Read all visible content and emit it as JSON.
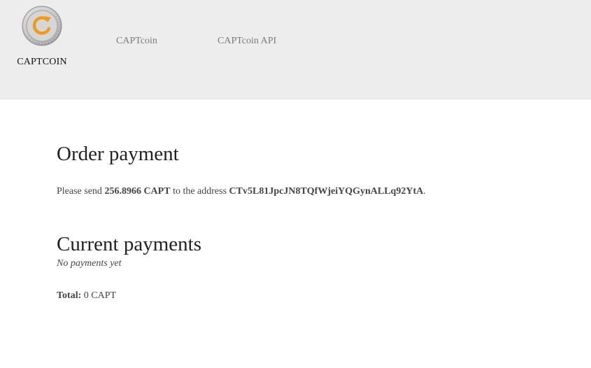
{
  "brand": {
    "name": "CAPTCOIN",
    "logo_icon": "captcoin-coin-icon",
    "logo_accent": "#f39a1a"
  },
  "nav": {
    "items": [
      {
        "label": "CAPTcoin"
      },
      {
        "label": "CAPTcoin API"
      }
    ]
  },
  "order": {
    "title": "Order payment",
    "text_before_amount": "Please send ",
    "amount": "256.8966 CAPT",
    "text_before_address": " to the address ",
    "address": "CTv5L81JpcJN8TQfWjeiYQGynALLq92YtA",
    "text_end": "."
  },
  "payments": {
    "title": "Current payments",
    "empty_note": "No payments yet",
    "total_label": "Total:",
    "total_value": " 0 CAPT"
  }
}
